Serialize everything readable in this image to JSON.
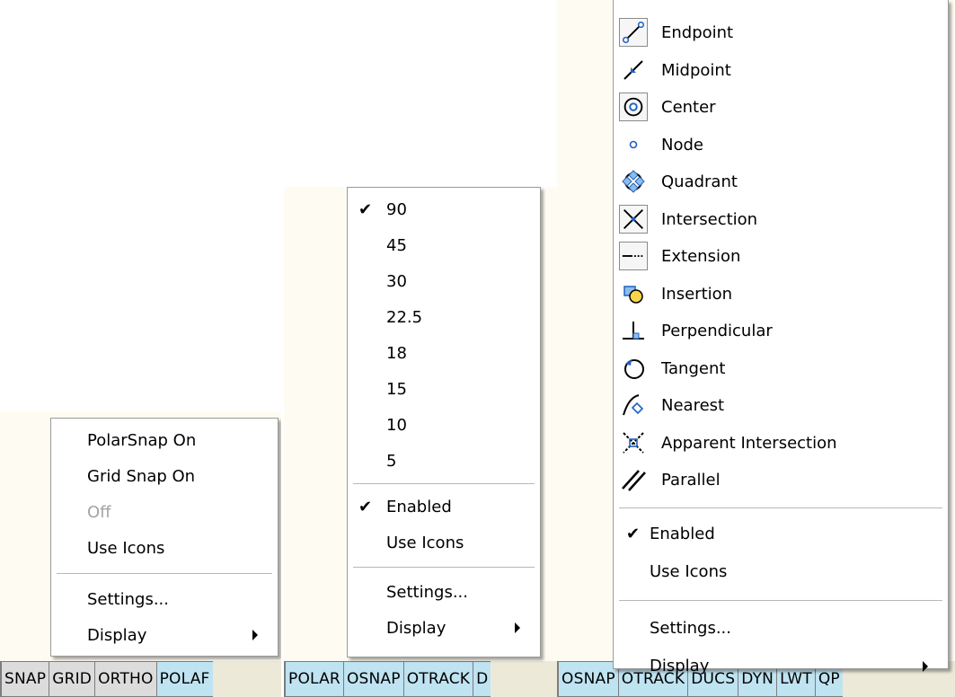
{
  "panel1": {
    "status_buttons": [
      {
        "label": "SNAP",
        "on": false
      },
      {
        "label": "GRID",
        "on": false
      },
      {
        "label": "ORTHO",
        "on": false
      },
      {
        "label": "POLAF",
        "on": true
      }
    ],
    "menu": {
      "items": [
        {
          "label": "PolarSnap On",
          "disabled": false
        },
        {
          "label": "Grid Snap On",
          "disabled": false
        },
        {
          "label": "Off",
          "disabled": true
        },
        {
          "label": "Use Icons",
          "disabled": false
        }
      ],
      "settings_label": "Settings...",
      "display_label": "Display"
    }
  },
  "panel2": {
    "status_buttons": [
      {
        "label": "POLAR",
        "on": true
      },
      {
        "label": "OSNAP",
        "on": true
      },
      {
        "label": "OTRACK",
        "on": true
      },
      {
        "label": "D",
        "on": true
      }
    ],
    "menu": {
      "angles": [
        {
          "label": "90",
          "checked": true
        },
        {
          "label": "45",
          "checked": false
        },
        {
          "label": "30",
          "checked": false
        },
        {
          "label": "22.5",
          "checked": false
        },
        {
          "label": "18",
          "checked": false
        },
        {
          "label": "15",
          "checked": false
        },
        {
          "label": "10",
          "checked": false
        },
        {
          "label": "5",
          "checked": false
        }
      ],
      "enabled_label": "Enabled",
      "use_icons_label": "Use Icons",
      "settings_label": "Settings...",
      "display_label": "Display",
      "check_glyph": "✔"
    }
  },
  "panel3": {
    "status_buttons": [
      {
        "label": "OSNAP",
        "on": true
      },
      {
        "label": "OTRACK",
        "on": true
      },
      {
        "label": "DUCS",
        "on": true
      },
      {
        "label": "DYN",
        "on": true
      },
      {
        "label": "LWT",
        "on": true
      },
      {
        "label": "QP",
        "on": true
      }
    ],
    "menu": {
      "snaps": [
        {
          "label": "Endpoint",
          "icon": "endpoint-icon"
        },
        {
          "label": "Midpoint",
          "icon": "midpoint-icon"
        },
        {
          "label": "Center",
          "icon": "center-icon"
        },
        {
          "label": "Node",
          "icon": "node-icon"
        },
        {
          "label": "Quadrant",
          "icon": "quadrant-icon"
        },
        {
          "label": "Intersection",
          "icon": "intersection-icon"
        },
        {
          "label": "Extension",
          "icon": "extension-icon"
        },
        {
          "label": "Insertion",
          "icon": "insertion-icon"
        },
        {
          "label": "Perpendicular",
          "icon": "perpendicular-icon"
        },
        {
          "label": "Tangent",
          "icon": "tangent-icon"
        },
        {
          "label": "Nearest",
          "icon": "nearest-icon"
        },
        {
          "label": "Apparent Intersection",
          "icon": "apparent-intersection-icon"
        },
        {
          "label": "Parallel",
          "icon": "parallel-icon"
        }
      ],
      "enabled_label": "Enabled",
      "use_icons_label": "Use Icons",
      "settings_label": "Settings...",
      "display_label": "Display",
      "check_glyph": "✔"
    }
  },
  "colors": {
    "status_on": "#bfe3f1",
    "status_off": "#dcdcdc",
    "icon_blue": "#2060c0",
    "disabled_text": "#a4a4a4"
  }
}
